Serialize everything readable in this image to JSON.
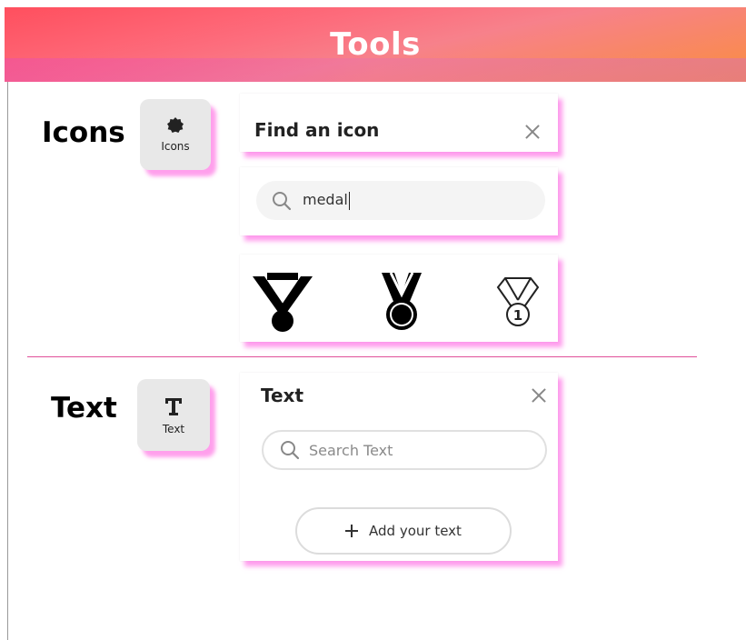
{
  "header": {
    "title": "Tools"
  },
  "icons_section": {
    "label": "Icons",
    "tile_label": "Icons",
    "tile_icon": "badge-icon",
    "panel_title": "Find an icon",
    "search_value": "medal",
    "results": [
      "medal-ribbon-solid-icon",
      "medal-ribbon-circle-icon",
      "medal-first-place-icon"
    ],
    "result_badge": "1"
  },
  "text_section": {
    "label": "Text",
    "tile_label": "Text",
    "tile_icon": "text-t-icon",
    "panel_title": "Text",
    "search_placeholder": "Search Text",
    "add_button_label": "Add your text"
  },
  "colors": {
    "accent_shadow": "#ff5ae1",
    "banner_start": "#ff4f5e",
    "banner_end": "#fa8d3f",
    "divider": "#e0509a"
  }
}
